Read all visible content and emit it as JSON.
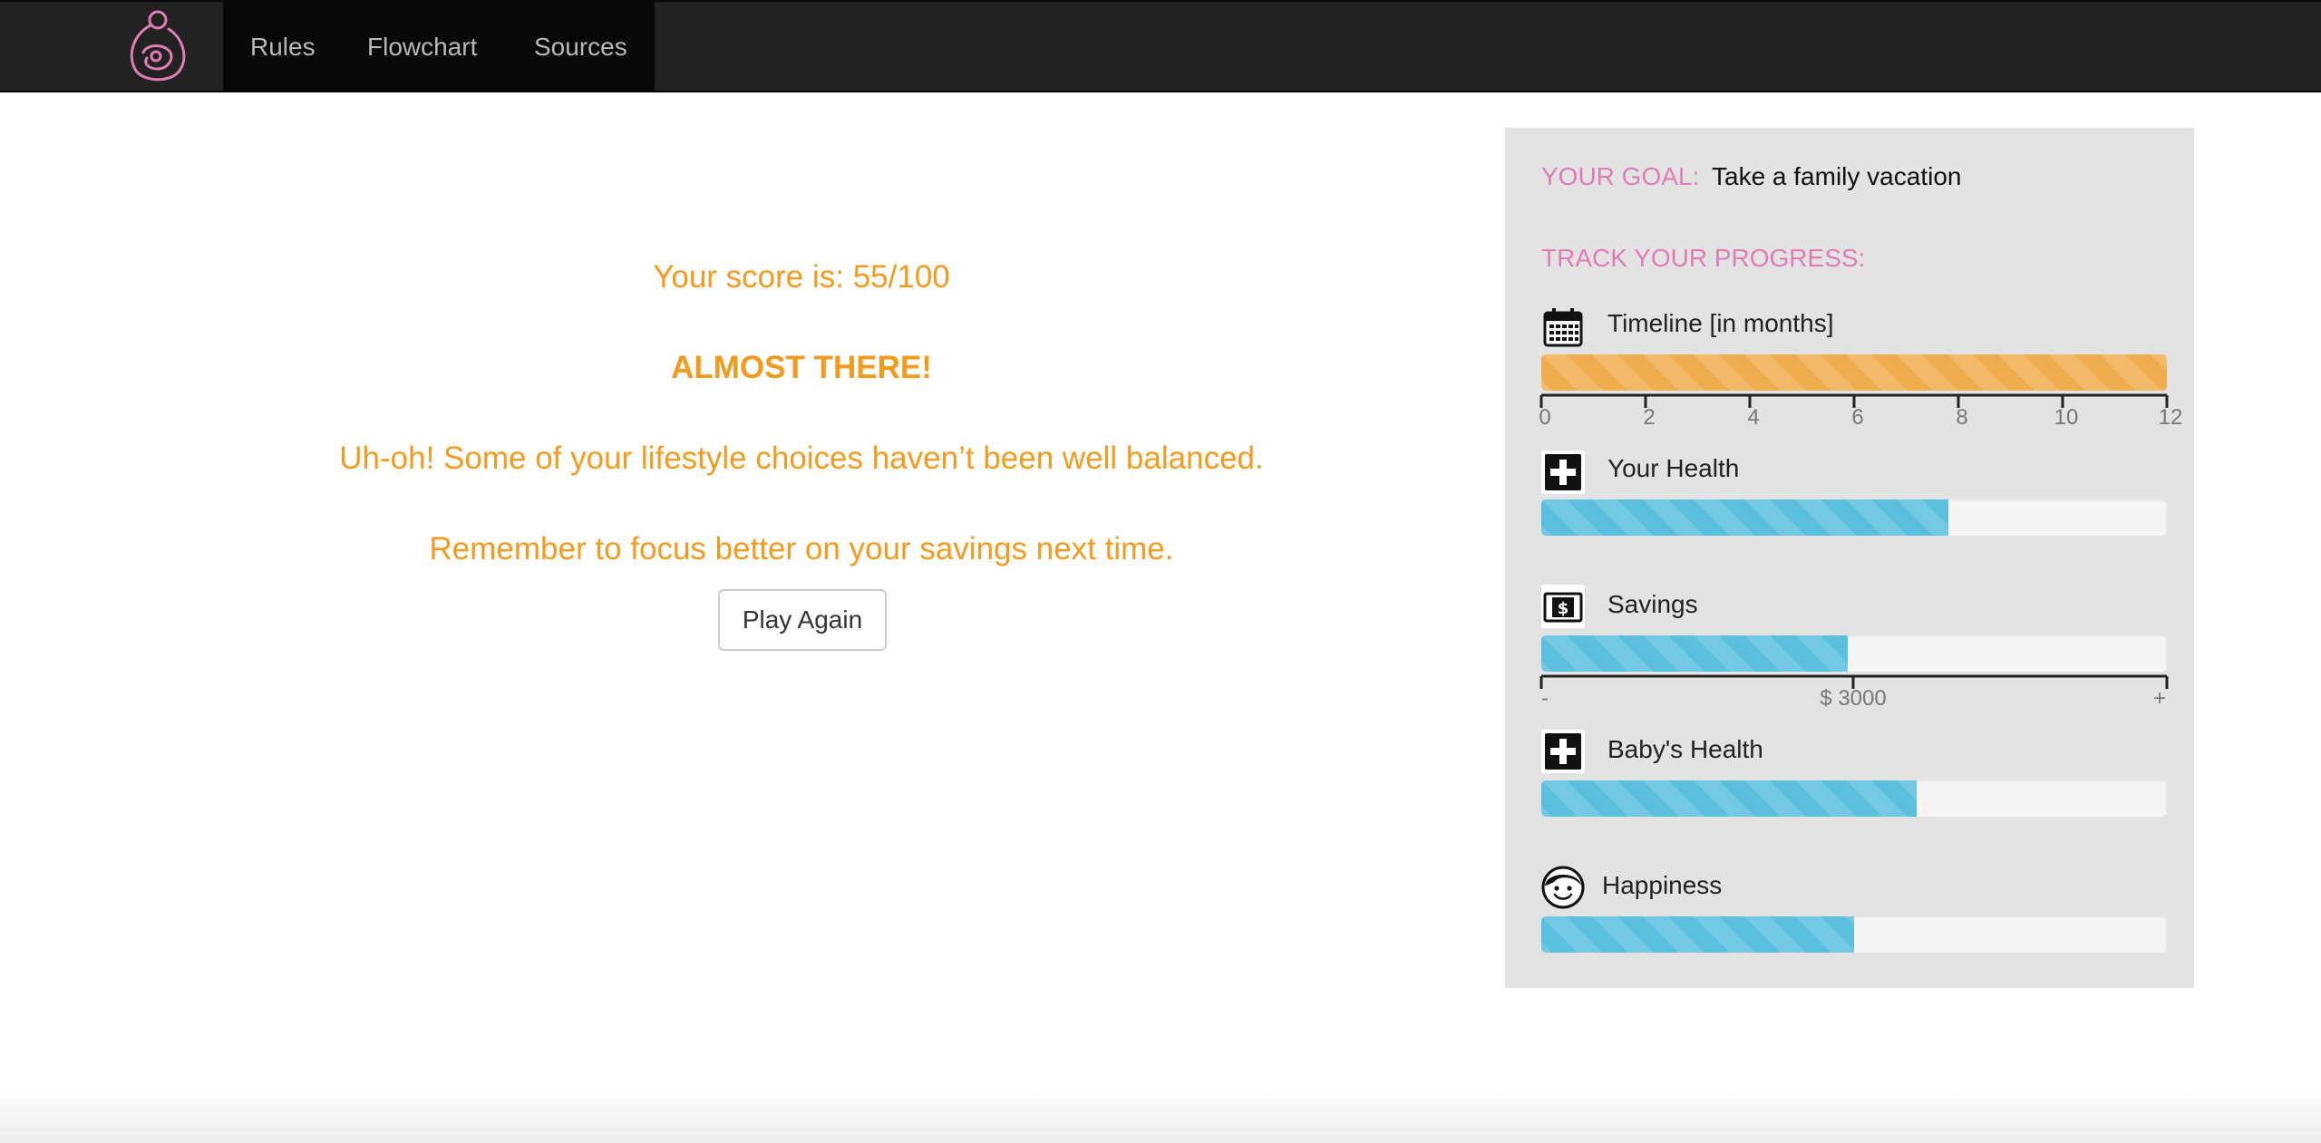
{
  "nav": {
    "items": [
      {
        "label": "Rules"
      },
      {
        "label": "Flowchart"
      },
      {
        "label": "Sources"
      }
    ],
    "logo_icon": "mother-baby-logo-icon",
    "logo_color": "#e07db4"
  },
  "result": {
    "score_text": "Your score is: 55/100",
    "verdict": "ALMOST THERE!",
    "message_1": "Uh-oh! Some of your lifestyle choices haven’t been well balanced.",
    "message_2": "Remember to focus better on your savings next time.",
    "play_again_label": "Play Again",
    "text_color": "#f49b1f"
  },
  "panel": {
    "goal_label": "YOUR GOAL:",
    "goal_value": "Take a family vacation",
    "track_label": "TRACK YOUR PROGRESS:",
    "accent_color": "#e07db4",
    "timeline": {
      "label": "Timeline [in months]",
      "icon": "calendar-icon",
      "progress": 1.0,
      "ticks": [
        "0",
        "2",
        "4",
        "6",
        "8",
        "10",
        "12"
      ]
    },
    "health": {
      "label": "Your Health",
      "icon": "medical-cross-icon",
      "progress": 0.65
    },
    "savings": {
      "label": "Savings",
      "icon": "dollar-bill-icon",
      "progress": 0.49,
      "scale_min": "-",
      "scale_mid": "$ 3000",
      "scale_max": "+"
    },
    "baby_health": {
      "label": "Baby's Health",
      "icon": "medical-cross-icon",
      "progress": 0.6
    },
    "happiness": {
      "label": "Happiness",
      "icon": "smiley-face-icon",
      "progress": 0.5
    }
  }
}
